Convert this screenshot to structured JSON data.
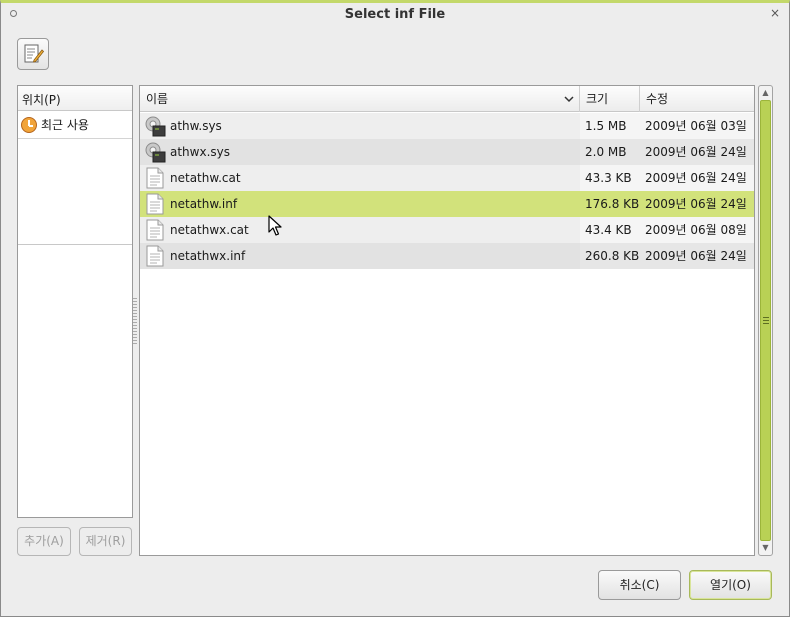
{
  "window": {
    "title": "Select  inf File",
    "close_glyph": "×"
  },
  "toolbar": {
    "edit_icon": "edit-location-icon"
  },
  "places": {
    "header": "위치(P)",
    "items": [
      {
        "label": "최근 사용",
        "icon": "recent-icon"
      }
    ],
    "add_button": "추가(A)",
    "remove_button": "제거(R)"
  },
  "file_list": {
    "columns": {
      "name": "이름",
      "size": "크기",
      "modified": "수정"
    },
    "rows": [
      {
        "name": "athw.sys",
        "size": "1.5 MB",
        "modified": "2009년 06월 03일",
        "icon": "system-file-icon",
        "selected": false
      },
      {
        "name": "athwx.sys",
        "size": "2.0 MB",
        "modified": "2009년 06월 24일",
        "icon": "system-file-icon",
        "selected": false
      },
      {
        "name": "netathw.cat",
        "size": "43.3 KB",
        "modified": "2009년 06월 24일",
        "icon": "text-file-icon",
        "selected": false
      },
      {
        "name": "netathw.inf",
        "size": "176.8 KB",
        "modified": "2009년 06월 24일",
        "icon": "text-file-icon",
        "selected": true
      },
      {
        "name": "netathwx.cat",
        "size": "43.4 KB",
        "modified": "2009년 06월 08일",
        "icon": "text-file-icon",
        "selected": false
      },
      {
        "name": "netathwx.inf",
        "size": "260.8 KB",
        "modified": "2009년 06월 24일",
        "icon": "text-file-icon",
        "selected": false
      }
    ]
  },
  "buttons": {
    "cancel": "취소(C)",
    "open": "열기(O)"
  },
  "colors": {
    "selection": "#d2e27b",
    "scrollbar_thumb": "#b9d155",
    "title_accent": "#c3d86a"
  }
}
